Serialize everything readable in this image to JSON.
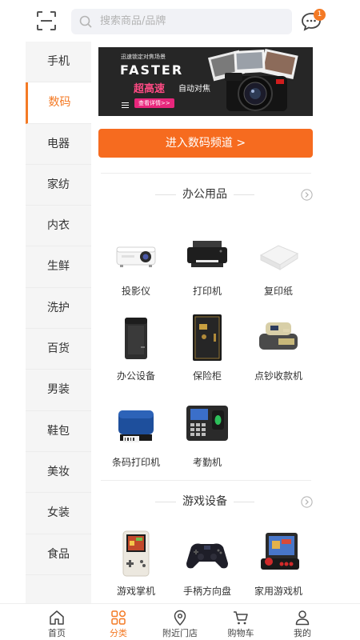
{
  "header": {
    "search_placeholder": "搜索商品/品牌",
    "message_badge": "1"
  },
  "sidebar": {
    "items": [
      {
        "label": "手机"
      },
      {
        "label": "数码",
        "active": true
      },
      {
        "label": "电器"
      },
      {
        "label": "家纺"
      },
      {
        "label": "内衣"
      },
      {
        "label": "生鲜"
      },
      {
        "label": "洗护"
      },
      {
        "label": "百货"
      },
      {
        "label": "男装"
      },
      {
        "label": "鞋包"
      },
      {
        "label": "美妆"
      },
      {
        "label": "女装"
      },
      {
        "label": "食品"
      }
    ]
  },
  "banner": {
    "small_text": "迅速锁定对焦场景",
    "big_text": "FASTER",
    "red_text": "超高速",
    "white_text": "自动对焦",
    "button_text": "查看详情>>"
  },
  "channel_button": "进入数码频道 >",
  "sections": [
    {
      "title": "办公用品",
      "products": [
        {
          "name": "投影仪",
          "icon": "projector"
        },
        {
          "name": "打印机",
          "icon": "printer"
        },
        {
          "name": "复印纸",
          "icon": "copy-paper"
        },
        {
          "name": "办公设备",
          "icon": "shredder"
        },
        {
          "name": "保险柜",
          "icon": "safe"
        },
        {
          "name": "点钞收款机",
          "icon": "money-counter"
        },
        {
          "name": "条码打印机",
          "icon": "barcode-printer"
        },
        {
          "name": "考勤机",
          "icon": "attendance-machine"
        }
      ]
    },
    {
      "title": "游戏设备",
      "products": [
        {
          "name": "游戏掌机",
          "icon": "handheld-console"
        },
        {
          "name": "手柄方向盘",
          "icon": "gamepad"
        },
        {
          "name": "家用游戏机",
          "icon": "arcade-machine"
        }
      ]
    }
  ],
  "tabbar": {
    "items": [
      {
        "label": "首页",
        "icon": "home-icon"
      },
      {
        "label": "分类",
        "icon": "category-icon",
        "active": true
      },
      {
        "label": "附近门店",
        "icon": "location-icon"
      },
      {
        "label": "购物车",
        "icon": "cart-icon"
      },
      {
        "label": "我的",
        "icon": "user-icon"
      }
    ]
  },
  "colors": {
    "accent": "#f47a25",
    "channel_button": "#f66b1f"
  }
}
